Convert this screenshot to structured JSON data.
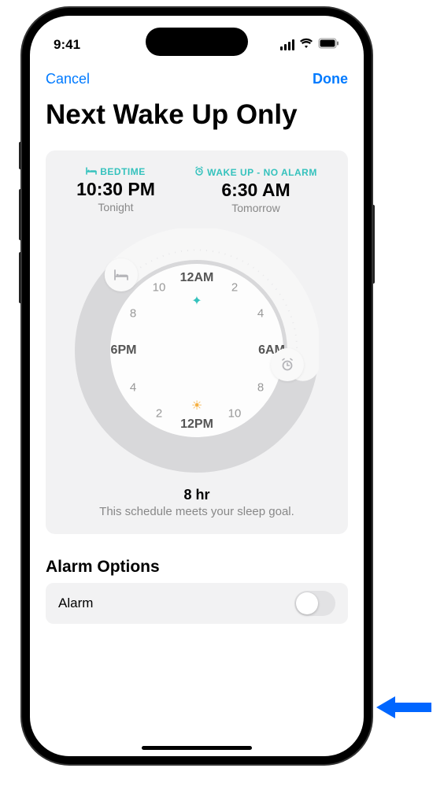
{
  "status": {
    "time": "9:41"
  },
  "nav": {
    "cancel": "Cancel",
    "done": "Done"
  },
  "title": "Next Wake Up Only",
  "schedule": {
    "bedtime": {
      "label": "BEDTIME",
      "time": "10:30 PM",
      "day": "Tonight"
    },
    "wakeup": {
      "label": "WAKE UP - NO ALARM",
      "time": "6:30 AM",
      "day": "Tomorrow"
    }
  },
  "clock": {
    "labels": {
      "h12am": "12AM",
      "h2": "2",
      "h4": "4",
      "h6am": "6AM",
      "h8": "8",
      "h10": "10",
      "h12pm": "12PM",
      "h14": "2",
      "h16": "4",
      "h6pm": "6PM",
      "h20": "8",
      "h22": "10"
    }
  },
  "summary": {
    "duration": "8 hr",
    "message": "This schedule meets your sleep goal."
  },
  "options": {
    "title": "Alarm Options",
    "alarm_label": "Alarm",
    "alarm_enabled": false
  }
}
